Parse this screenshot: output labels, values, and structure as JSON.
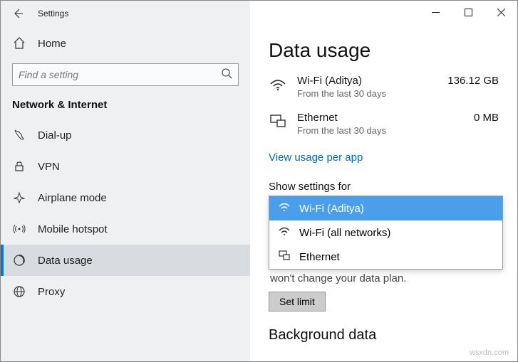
{
  "titlebar": {
    "title": "Settings"
  },
  "home": {
    "label": "Home"
  },
  "search": {
    "placeholder": "Find a setting"
  },
  "category": "Network & Internet",
  "nav": {
    "dialup": "Dial-up",
    "vpn": "VPN",
    "airplane": "Airplane mode",
    "hotspot": "Mobile hotspot",
    "datausage": "Data usage",
    "proxy": "Proxy"
  },
  "main": {
    "heading": "Data usage",
    "wifi": {
      "name": "Wi-Fi (Aditya)",
      "sub": "From the last 30 days",
      "value": "136.12 GB"
    },
    "eth": {
      "name": "Ethernet",
      "sub": "From the last 30 days",
      "value": "0 MB"
    },
    "link": "View usage per app",
    "showsettings_label": "Show settings for",
    "dd": {
      "opt1": "Wi-Fi (Aditya)",
      "opt2": "Wi-Fi (all networks)",
      "opt3": "Ethernet"
    },
    "note": "won't change your data plan.",
    "setlimit": "Set limit",
    "bg": "Background data"
  },
  "watermark": "wsxdn.com"
}
